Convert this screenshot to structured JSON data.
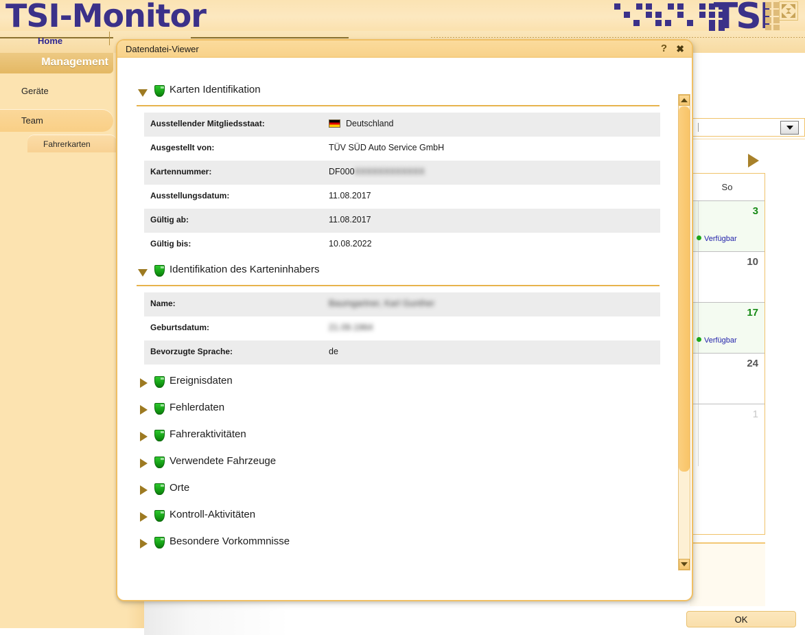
{
  "banner": {
    "title": "TSI-Monitor",
    "logo_text": "TSI",
    "expand_icon": "expand-arrows-icon"
  },
  "nav": {
    "home_label": "Home"
  },
  "sidebar": {
    "header_label": "Management",
    "items": [
      {
        "label": "Geräte",
        "selected": false
      },
      {
        "label": "Team",
        "selected": true
      }
    ],
    "sub_items": [
      {
        "label": "Fahrerkarten"
      }
    ]
  },
  "calendar": {
    "next_icon": "play-arrow-icon",
    "dropdown_icon": "chevron-down-icon",
    "column_header": "So",
    "days": [
      {
        "num": "3",
        "status": "Verfügbar",
        "available": true,
        "muted": false
      },
      {
        "num": "10",
        "status": "",
        "available": false,
        "muted": false
      },
      {
        "num": "17",
        "status": "Verfügbar",
        "available": true,
        "muted": false
      },
      {
        "num": "24",
        "status": "",
        "available": false,
        "muted": false
      },
      {
        "num": "1",
        "status": "",
        "available": false,
        "muted": true
      }
    ]
  },
  "dialog": {
    "title": "Datendatei-Viewer",
    "help_icon": "?",
    "close_icon": "✖",
    "ok_label": "OK",
    "scrollbar": {
      "up_icon": "triangle-up-icon",
      "down_icon": "triangle-down-icon"
    },
    "sections": [
      {
        "label": "Karten Identifikation",
        "expanded": true,
        "rows": [
          {
            "key": "Ausstellender Mitgliedsstaat:",
            "value": "Deutschland",
            "flag": "de-flag-icon",
            "shaded": true,
            "blurred": false
          },
          {
            "key": "Ausgestellt von:",
            "value": "TÜV SÜD Auto Service GmbH",
            "flag": "",
            "shaded": false,
            "blurred": false
          },
          {
            "key": "Kartennummer:",
            "value": "DF000XXXXXXXXXXXX",
            "flag": "",
            "shaded": true,
            "blurred": true
          },
          {
            "key": "Ausstellungsdatum:",
            "value": "11.08.2017",
            "flag": "",
            "shaded": false,
            "blurred": false
          },
          {
            "key": "Gültig ab:",
            "value": "11.08.2017",
            "flag": "",
            "shaded": true,
            "blurred": false
          },
          {
            "key": "Gültig bis:",
            "value": "10.08.2022",
            "flag": "",
            "shaded": false,
            "blurred": false
          }
        ]
      },
      {
        "label": "Identifikation des Karteninhabers",
        "expanded": true,
        "rows": [
          {
            "key": "Name:",
            "value": "Baumgartner, Karl Gunther",
            "flag": "",
            "shaded": true,
            "blurred": true
          },
          {
            "key": "Geburtsdatum:",
            "value": "21.09.1964",
            "flag": "",
            "shaded": false,
            "blurred": true
          },
          {
            "key": "Bevorzugte Sprache:",
            "value": "de",
            "flag": "",
            "shaded": true,
            "blurred": false
          }
        ]
      }
    ],
    "collapsed_sections": [
      {
        "label": "Ereignisdaten"
      },
      {
        "label": "Fehlerdaten"
      },
      {
        "label": "Fahreraktivitäten"
      },
      {
        "label": "Verwendete Fahrzeuge"
      },
      {
        "label": "Orte"
      },
      {
        "label": "Kontroll-Aktivitäten"
      },
      {
        "label": "Besondere Vorkommnisse"
      }
    ]
  },
  "colors": {
    "accent": "#f0bf63",
    "brand": "#3b3189",
    "shield_green": "#15a015",
    "available_green": "#168a16"
  }
}
